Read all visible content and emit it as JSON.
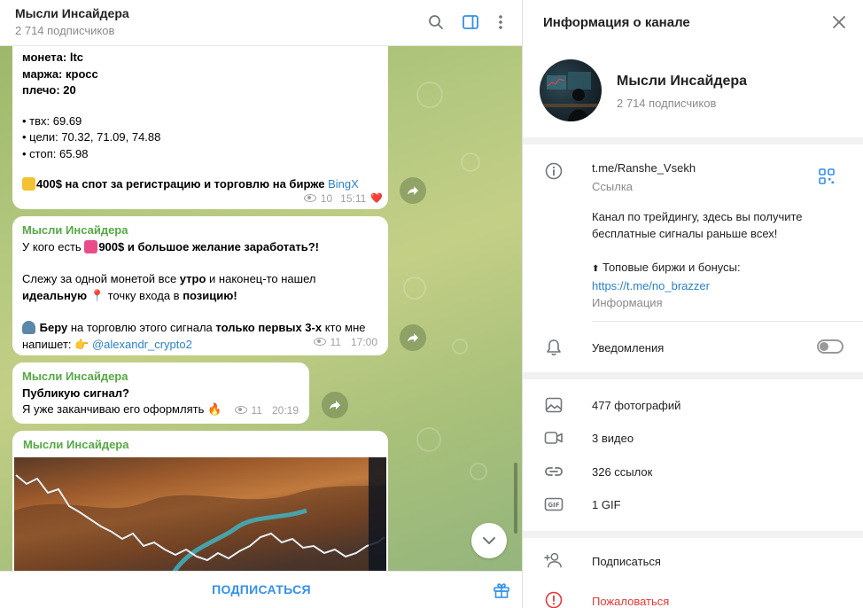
{
  "chat": {
    "title": "Мысли Инсайдера",
    "subscribers": "2 714 подписчиков",
    "icons": {
      "search": "search-icon",
      "sidebar": "sidebar-toggle-icon",
      "more": "more-vertical-icon"
    }
  },
  "messages": [
    {
      "lines": {
        "coin": "монета: ltc",
        "margin": "маржа: кросс",
        "leverage": "плечо: 20",
        "entry": "• твх: 69.69",
        "targets": "• цели: 70.32, 71.09, 74.88",
        "stop": "• стоп: 65.98",
        "promo_bold": "400$ на спот за регистрацию и торговлю на бирже",
        "promo_link": "BingX"
      },
      "views": "10",
      "time": "15:11",
      "reaction": "❤️"
    },
    {
      "sender": "Мысли Инсайдера",
      "p1_a": "У кого есть ",
      "p1_b": "900$ и большое желание заработать?!",
      "p2_a": "Слежу за одной монетой все ",
      "p2_b": "утро",
      "p2_c": " и наконец-то нашел",
      "p2_d": "идеальную",
      "p2_e": " точку входа в ",
      "p2_f": "позицию!",
      "p3_a": "Беру",
      "p3_b": " на торговлю этого сигнала ",
      "p3_c": "только первых 3-х",
      "p3_d": " кто мне",
      "p3_e": "напишет: ",
      "p3_link": "@alexandr_crypto2",
      "views": "11",
      "time": "17:00"
    },
    {
      "sender": "Мысли Инсайдера",
      "line1": "Публикую сигнал?",
      "line2": "Я уже заканчиваю его оформлять",
      "views": "11",
      "time": "20:19"
    },
    {
      "sender": "Мысли Инсайдера",
      "image": "chart-over-canyon-image"
    }
  ],
  "footer": {
    "subscribe": "ПОДПИСАТЬСЯ",
    "gift_icon": "gift-icon"
  },
  "info": {
    "header": "Информация о канале",
    "name": "Мысли Инсайдера",
    "subscribers": "2 714 подписчиков",
    "link": "t.me/Ranshe_Vsekh",
    "link_label": "Ссылка",
    "desc_line1": "Канал по трейдингу, здесь вы получите",
    "desc_line2": "бесплатные сигналы раньше всех!",
    "desc_line3": "Топовые биржи и бонусы:",
    "desc_link": "https://t.me/no_brazzer",
    "desc_label": "Информация",
    "notifications": "Уведомления",
    "notifications_on": false,
    "media": {
      "photos": "477 фотографий",
      "videos": "3 видео",
      "links": "326 ссылок",
      "gifs": "1 GIF"
    },
    "subscribe": "Подписаться",
    "report": "Пожаловаться"
  },
  "colors": {
    "accent": "#3390ec",
    "sender": "#56a845",
    "link": "#2b82c9",
    "report": "#e53935"
  }
}
